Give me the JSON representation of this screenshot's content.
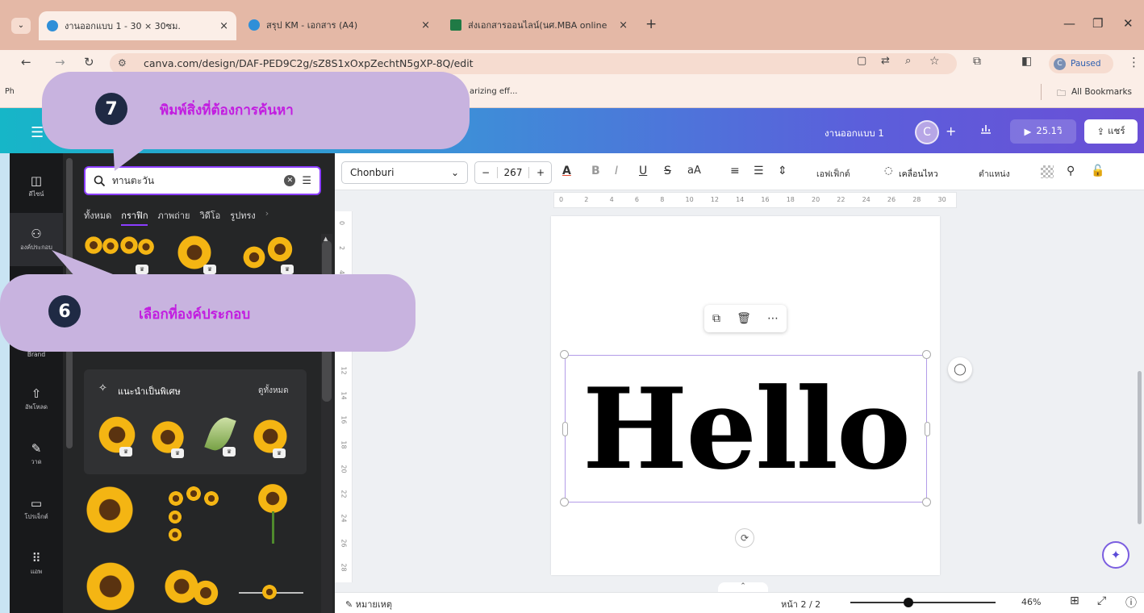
{
  "browser": {
    "tabs": [
      {
        "label": "งานออกแบบ 1 - 30 × 30ซม.",
        "close": "×"
      },
      {
        "label": "สรุป KM - เอกสาร (A4)",
        "close": "×"
      },
      {
        "label": "ส่งเอกสารออนไลน์(นศ.MBA online",
        "close": "×"
      }
    ],
    "new_tab": "+",
    "window": {
      "minimize": "—",
      "restore": "❐",
      "close": "✕"
    },
    "url": "canva.com/design/DAF-PED9C2g/sZ8S1xOxpZechtN5gXP-8Q/edit",
    "profile_status": "Paused",
    "bookmarks": {
      "left": "Ph",
      "middle": "arizing eff...",
      "all": "All Bookmarks"
    }
  },
  "canva": {
    "doc_title": "งานออกแบบ 1",
    "avatar_initial": "C",
    "add": "+",
    "present_label": "25.1วิ",
    "share_label": "แชร์"
  },
  "rail": [
    {
      "label": "ดีไซน์",
      "icon": "template-icon"
    },
    {
      "label": "องค์ประกอบ",
      "icon": "elements-icon"
    },
    {
      "label": "Brand",
      "icon": "brand-icon"
    },
    {
      "label": "อัพโหลด",
      "icon": "upload-icon"
    },
    {
      "label": "วาด",
      "icon": "draw-icon"
    },
    {
      "label": "โปรเจ็กต์",
      "icon": "folder-icon"
    },
    {
      "label": "แอพ",
      "icon": "apps-icon"
    }
  ],
  "panel": {
    "search_value": "ทานตะวัน",
    "categories": [
      "ทั้งหมด",
      "กราฟิก",
      "ภาพถ่าย",
      "วิดีโอ",
      "รูปทรง"
    ],
    "active_category": "กราฟิก",
    "recommended_title": "แนะนำเป็นพิเศษ",
    "see_all": "ดูทั้งหมด"
  },
  "toolbar": {
    "font": "Chonburi",
    "font_size": "267",
    "minus": "−",
    "plus": "+",
    "effects": "เอฟเฟ็กต์",
    "animate": "เคลื่อนไหว",
    "position": "ตำแหน่ง"
  },
  "ruler": {
    "marks": [
      "0",
      "2",
      "4",
      "6",
      "8",
      "10",
      "12",
      "14",
      "16",
      "18",
      "20",
      "22",
      "24",
      "26",
      "28",
      "30"
    ]
  },
  "canvas": {
    "text": "Hello"
  },
  "bottom": {
    "notes": "หมายเหตุ",
    "page_indicator": "หน้า 2 / 2",
    "zoom": "46%"
  },
  "callouts": [
    {
      "number": "7",
      "text": "พิมพ์สิ่งที่ต้องการค้นหา"
    },
    {
      "number": "6",
      "text": "เลือกที่องค์ประกอบ"
    }
  ],
  "colors": {
    "accent": "#8b3dff",
    "callout_bg": "#c8b3df",
    "callout_text": "#c21de0",
    "callout_badge": "#1f2a44"
  }
}
